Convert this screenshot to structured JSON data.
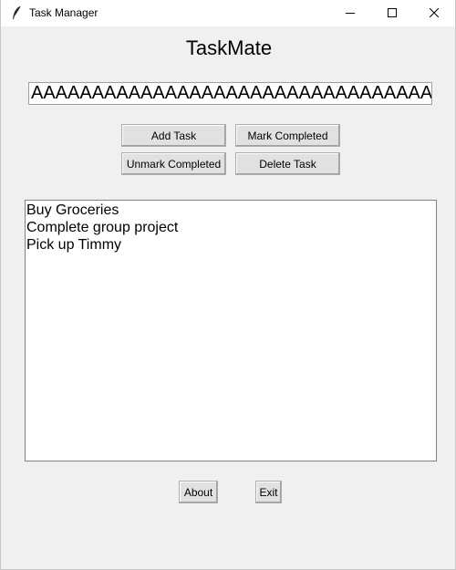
{
  "window": {
    "title": "Task Manager"
  },
  "header": {
    "title": "TaskMate"
  },
  "entry": {
    "value": "AAAAAAAAAAAAAAAAAAAAAAAAAAAAAAAAAAAA"
  },
  "buttons": {
    "add": "Add Task",
    "mark": "Mark Completed",
    "unmark": "Unmark Completed",
    "delete": "Delete Task",
    "about": "About",
    "exit": "Exit"
  },
  "tasks": [
    "Buy Groceries",
    "Complete group project",
    "Pick up Timmy"
  ],
  "icons": {
    "app": "feather-icon",
    "minimize": "minimize-icon",
    "maximize": "maximize-icon",
    "close": "close-icon"
  }
}
